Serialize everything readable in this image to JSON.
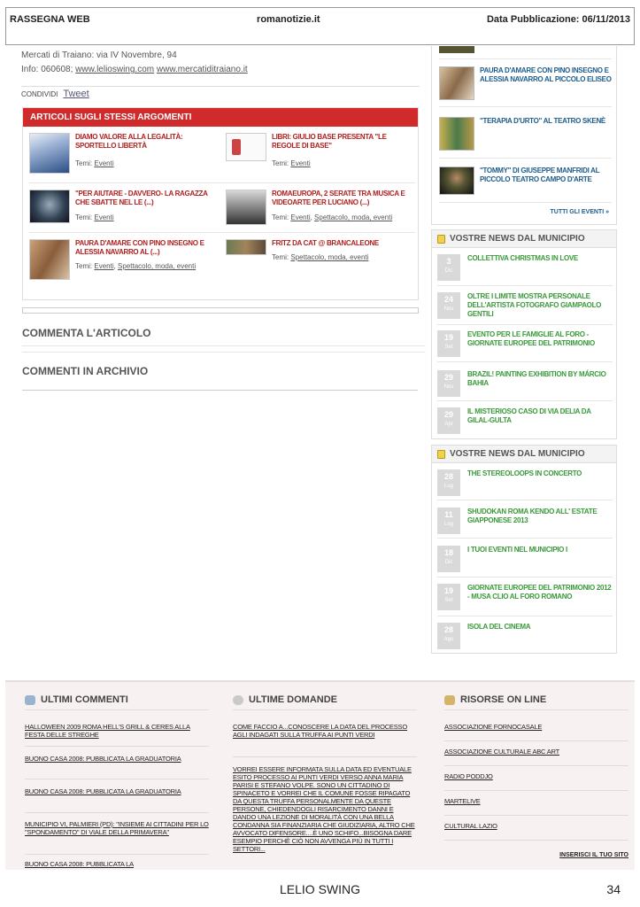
{
  "press_header": {
    "left": "RASSEGNA WEB",
    "center": "romanotizie.it",
    "right": "Data Pubblicazione: 06/11/2013"
  },
  "venue": {
    "line1": "Mercati di Traiano: via IV Novembre, 94",
    "info_prefix": "Info: 060608;",
    "link1": "www.lelioswing.com",
    "link2": "www.mercatiditraiano.it"
  },
  "share": {
    "label": "CONDIVIDI",
    "tweet": "Tweet"
  },
  "related": {
    "header": "ARTICOLI SUGLI STESSI ARGOMENTI",
    "items": [
      {
        "title": "DIAMO VALORE ALLA LEGALITÀ: SPORTELLO LIBERTÀ",
        "tags_label": "Temi:",
        "tags": [
          "Eventi"
        ]
      },
      {
        "title": "LIBRI: GIULIO BASE PRESENTA \"LE REGOLE DI BASE\"",
        "tags_label": "Temi:",
        "tags": [
          "Eventi"
        ]
      },
      {
        "title": "\"PER AIUTARE - DAVVERO- LA RAGAZZA CHE SBATTE NEL LE (...)",
        "tags_label": "Temi:",
        "tags": [
          "Eventi"
        ]
      },
      {
        "title": "ROMAEUROPA, 2 SERATE TRA MUSICA E VIDEOARTE PER LUCIANO (...)",
        "tags_label": "Temi:",
        "tags": [
          "Eventi",
          "Spettacolo, moda, eventi"
        ]
      },
      {
        "title": "PAURA D'AMARE CON PINO INSEGNO E ALESSIA NAVARRO AL (...)",
        "tags_label": "Temi:",
        "tags": [
          "Eventi",
          "Spettacolo, moda, eventi"
        ]
      },
      {
        "title": "FRITZ DA CAT @ BRANCALEONE",
        "tags_label": "Temi:",
        "tags": [
          "Spettacolo, moda, eventi"
        ]
      }
    ]
  },
  "sections": {
    "comment": "COMMENTA L'ARTICOLO",
    "archive": "COMMENTI IN ARCHIVIO"
  },
  "events": {
    "items": [
      {
        "title": "PAURA D'AMARE CON PINO INSEGNO E ALESSIA NAVARRO AL PICCOLO ELISEO"
      },
      {
        "title": "\"TERAPIA D'URTO\" AL TEATRO SKENÈ"
      },
      {
        "title": "\"TOMMY\" DI GIUSEPPE MANFRIDI AL PICCOLO TEATRO CAMPO D'ARTE"
      }
    ],
    "all_link": "TUTTI GLI EVENTI »"
  },
  "news1": {
    "header": "VOSTRE NEWS DAL MUNICIPIO",
    "items": [
      {
        "day": "3",
        "mon": "Dic",
        "title": "COLLETTIVA CHRISTMAS IN LOVE"
      },
      {
        "day": "24",
        "mon": "Nov",
        "title": "OLTRE I LIMITE MOSTRA PERSONALE DELL'ARTISTA FOTOGRAFO GIAMPAOLO GENTILI"
      },
      {
        "day": "19",
        "mon": "Set",
        "title": "EVENTO PER LE FAMIGLIE AL FORO - GIORNATE EUROPEE DEL PATRIMONIO"
      },
      {
        "day": "29",
        "mon": "Nov",
        "title": "BRAZIL! PAINTING EXHIBITION BY MÁRCIO BAHIA"
      },
      {
        "day": "29",
        "mon": "Apr",
        "title": "IL MISTERIOSO CASO DI VIA DELIA DA GILAL-GULTA"
      }
    ]
  },
  "news2": {
    "header": "VOSTRE NEWS DAL MUNICIPIO",
    "items": [
      {
        "day": "28",
        "mon": "Lug",
        "title": "THE STEREOLOOPS IN CONCERTO"
      },
      {
        "day": "11",
        "mon": "Lug",
        "title": "SHUDOKAN ROMA KENDO ALL' ESTATE GIAPPONESE 2013"
      },
      {
        "day": "18",
        "mon": "Dic",
        "title": "I TUOI EVENTI NEL MUNICIPIO I"
      },
      {
        "day": "19",
        "mon": "Set",
        "title": "GIORNATE EUROPEE DEL PATRIMONIO 2012 - MUSA CLIO AL FORO ROMANO"
      },
      {
        "day": "28",
        "mon": "Ago",
        "title": "ISOLA DEL CINEMA"
      }
    ]
  },
  "footer": {
    "comments": {
      "header": "ULTIMI COMMENTI",
      "items": [
        "HALLOWEEN 2009 ROMA HELL'S GRILL & CERES ALLA FESTA DELLE STREGHE",
        "BUONO CASA 2008: PUBBLICATA LA GRADUATORIA",
        "BUONO CASA 2008: PUBBLICATA LA GRADUATORIA",
        "MUNICIPIO VI, PALMIERI (PD): \"INSIEME AI CITTADINI PER LO \"SPONDAMENTO\" DI VIALE DELLA PRIMAVERA\"",
        "BUONO CASA 2008: PUBBLICATA LA"
      ]
    },
    "questions": {
      "header": "ULTIME DOMANDE",
      "items": [
        "COME FACCIO A...CONOSCERE LA DATA DEL PROCESSO AGLI INDAGATI SULLA TRUFFA AI PUNTI VERDI",
        "VORREI ESSERE INFORMATA SULLA DATA ED EVENTUALE ESITO PROCESSO AI PUNTI VERDI VERSO ANNA MARIA PARISI E STEFANO VOLPE. SONO UN CITTADINO DI SPINACETO E VORREI CHE IL COMUNE FOSSE RIPAGATO DA QUESTA TRUFFA PERSONALMENTE DA QUESTE PERSONE, CHIEDENDOGLI RISARCIMENTO DANNI E DANDO UNA LEZIONE DI MORALITÀ CON UNA BELLA CONDANNA SIA FINANZIARIA CHE GIUDIZIARIA, ALTRO CHE AVVOCATO DIFENSORE....È UNO SCHIFO...BISOGNA DARE ESEMPIO PERCHÈ CIÒ NON AVVENGA PIÙ IN TUTTI I SETTORI..."
      ]
    },
    "resources": {
      "header": "RISORSE ON LINE",
      "items": [
        "ASSOCIAZIONE FORNOCASALE",
        "ASSOCIAZIONE CULTURALE ABC ART",
        "RADIO PODDJO",
        "MARTELIVE",
        "CULTURAL LAZIO"
      ],
      "insert": "INSERISCI IL TUO SITO"
    }
  },
  "page_footer": {
    "name": "LELIO SWING",
    "number": "34"
  },
  "colors": {
    "related_header": "#d12a2a",
    "related_title": "#b31d1d",
    "event_title": "#1d5d8c",
    "news_title": "#3a9a3a"
  }
}
